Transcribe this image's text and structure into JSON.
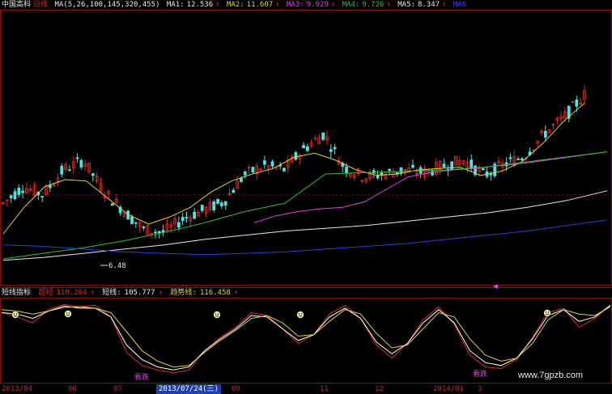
{
  "colors": {
    "background": "#000000",
    "frame": "#8a1010",
    "candle_up": "#e02828",
    "candle_down": "#52e0e0",
    "ma1": "#ffffff",
    "ma2": "#e0d040",
    "ma3": "#e040e0",
    "ma4": "#30c030",
    "ma5": "#e8e8e8",
    "ma6": "#2840e0",
    "short_line": "#ffffff",
    "trend_line": "#e0d040",
    "ultra_short_line": "#e02828",
    "label_red": "#e02828",
    "label_blue": "#4040ff",
    "label_magenta": "#e040e0"
  },
  "header": {
    "stock_name": "中国高科",
    "period": "日线",
    "ma_params": "MA(5,26,100,145,320,455)",
    "ma1_label": "MA1:",
    "ma1_value": "12.536",
    "ma2_label": "MA2:",
    "ma2_value": "11.607",
    "ma3_label": "MA3:",
    "ma3_value": "9.929",
    "ma4_label": "MA4:",
    "ma4_value": "9.726",
    "ma5_label": "MA5:",
    "ma5_value": "8.347",
    "ma6_label": "MA6"
  },
  "indicator": {
    "name": "短线指标",
    "ultra_label": "超短",
    "ultra_value": "110.264",
    "short_label": "短线:",
    "short_value": "105.777",
    "trend_label": "趋势线:",
    "trend_value": "116.458",
    "bottom_label": "看跌"
  },
  "low_price_label": "6.48",
  "time_axis": {
    "labels": [
      "2013/04",
      "06",
      "07",
      "09",
      "11",
      "12",
      "2014/01",
      "3"
    ],
    "cursor_label": "2013/07/24(三)"
  },
  "watermark": "www.7gpzb.com",
  "chart_data": [
    {
      "type": "line",
      "title": "中国高科 日线",
      "series": [
        {
          "name": "MA1",
          "values": [
            9.2,
            10.4,
            9.8,
            11.6,
            12.3,
            10.1,
            8.7,
            7.3,
            7.1,
            8.1,
            8.7,
            9.3,
            11.2,
            11.9,
            11.6,
            13.1,
            14.2,
            11.8,
            11.1,
            11.3,
            11.6,
            11.4,
            11.9,
            12.3,
            11.2,
            12.0,
            12.6,
            14.2,
            15.4,
            17.0
          ]
        },
        {
          "name": "MA2",
          "values": [
            7.0,
            8.9,
            10.4,
            10.9,
            10.8,
            9.6,
            8.4,
            7.7,
            8.2,
            8.9,
            10.0,
            10.8,
            11.3,
            11.7,
            12.5,
            12.8,
            12.3,
            11.6,
            11.2,
            11.3,
            11.6,
            11.7,
            11.8,
            11.2,
            11.5,
            12.2,
            13.5,
            15.1,
            16.4
          ]
        },
        {
          "name": "MA3",
          "values": [
            null,
            null,
            null,
            null,
            null,
            null,
            7.8,
            8.3,
            8.6,
            8.8,
            8.9,
            9.3,
            10.2,
            11.1,
            11.4,
            11.6,
            11.7,
            11.9,
            12.1,
            12.3,
            12.5,
            12.7,
            12.9
          ]
        },
        {
          "name": "MA4",
          "values": [
            5.2,
            5.6,
            6.0,
            6.5,
            7.1,
            7.8,
            8.6,
            9.2,
            11.3,
            11.4,
            11.5,
            11.6,
            11.8,
            12.1,
            12.5,
            12.9
          ]
        },
        {
          "name": "MA5",
          "values": [
            5.1,
            5.3,
            5.6,
            5.9,
            6.2,
            6.6,
            6.9,
            7.2,
            7.4,
            7.6,
            7.9,
            8.2,
            8.5,
            8.9,
            9.4,
            10.1
          ]
        },
        {
          "name": "MA6",
          "values": [
            6.2,
            6.1,
            5.9,
            5.7,
            5.6,
            5.5,
            5.6,
            5.7,
            5.9,
            6.1,
            6.3,
            6.6,
            6.9,
            7.2,
            7.6,
            8.0
          ]
        }
      ],
      "annotations": [
        "6.48"
      ]
    },
    {
      "type": "line",
      "title": "短线指标",
      "series": [
        {
          "name": "超短",
          "values": [
            92,
            86,
            78,
            96,
            103,
            100,
            102,
            86,
            38,
            20,
            14,
            10,
            14,
            40,
            58,
            72,
            92,
            88,
            70,
            50,
            62,
            90,
            102,
            84,
            48,
            30,
            50,
            82,
            100,
            76,
            34,
            18,
            16,
            28,
            58,
            92,
            98,
            72,
            84,
            102
          ]
        },
        {
          "name": "短线",
          "values": [
            92,
            90,
            84,
            94,
            101,
            98,
            98,
            86,
            48,
            28,
            18,
            14,
            18,
            40,
            56,
            70,
            88,
            86,
            70,
            54,
            62,
            86,
            98,
            84,
            52,
            36,
            50,
            78,
            96,
            78,
            40,
            24,
            20,
            30,
            56,
            88,
            96,
            80,
            86,
            102
          ]
        },
        {
          "name": "趋势线",
          "values": [
            96,
            94,
            90,
            94,
            99,
            100,
            98,
            92,
            66,
            40,
            26,
            18,
            20,
            38,
            54,
            68,
            84,
            88,
            78,
            60,
            62,
            80,
            96,
            90,
            64,
            44,
            48,
            70,
            92,
            86,
            56,
            34,
            26,
            30,
            50,
            82,
            96,
            90,
            88,
            100
          ]
        }
      ],
      "annotations": [
        "看跌",
        "看跌"
      ]
    }
  ]
}
